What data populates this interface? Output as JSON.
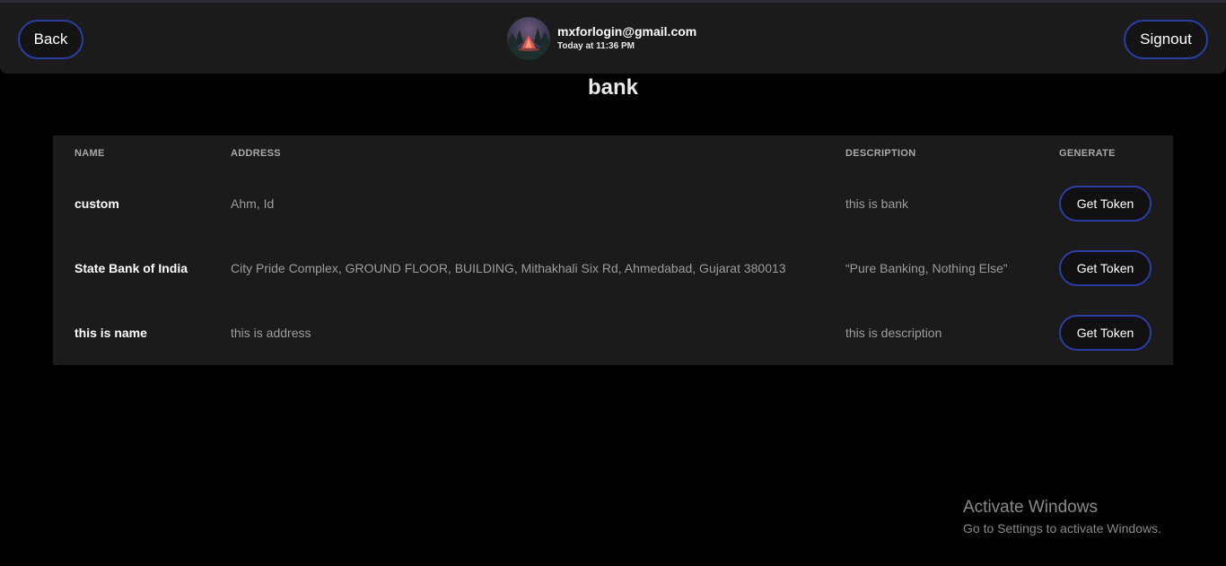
{
  "header": {
    "back_label": "Back",
    "signout_label": "Signout",
    "user": {
      "email": "mxforlogin@gmail.com",
      "time": "Today at 11:36 PM",
      "avatar_icon": "avatar-camp-image"
    }
  },
  "page": {
    "title": "bank"
  },
  "table": {
    "columns": [
      "NAME",
      "ADDRESS",
      "DESCRIPTION",
      "GENERATE"
    ],
    "rows": [
      {
        "name": "custom",
        "address": "Ahm, Id",
        "description": "this is bank",
        "action": "Get Token"
      },
      {
        "name": "State Bank of India",
        "address": "City Pride Complex, GROUND FLOOR, BUILDING, Mithakhali Six Rd, Ahmedabad, Gujarat 380013",
        "description": "“Pure Banking, Nothing Else”",
        "action": "Get Token"
      },
      {
        "name": "this is name",
        "address": "this is address",
        "description": "this is description",
        "action": "Get Token"
      }
    ]
  },
  "watermark": {
    "title": "Activate Windows",
    "subtitle": "Go to Settings to activate Windows."
  },
  "colors": {
    "background": "#000000",
    "panel": "#1b1b1b",
    "accent_border": "#2a3fa3",
    "muted_text": "#9c9c9c"
  }
}
